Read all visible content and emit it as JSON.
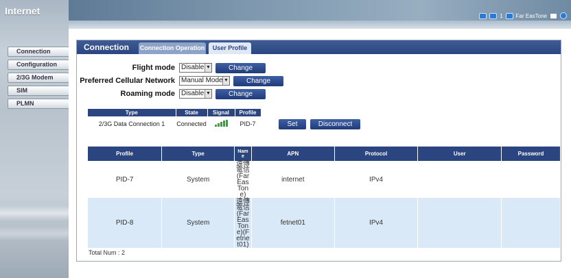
{
  "app": {
    "title": "Internet"
  },
  "sidebar": {
    "items": [
      {
        "label": "Connection"
      },
      {
        "label": "Configuration"
      },
      {
        "label": "2/3G Modem"
      },
      {
        "label": "SIM"
      },
      {
        "label": "PLMN"
      }
    ]
  },
  "status_bar": {
    "count": "1",
    "operator": "Far EasTone"
  },
  "panel": {
    "title": "Connection",
    "tabs": [
      {
        "label": "Connection Operation",
        "active": false
      },
      {
        "label": "User Profile",
        "active": true
      }
    ]
  },
  "form": {
    "flight_mode": {
      "label": "Flight mode",
      "value": "Disable",
      "button": "Change"
    },
    "preferred_network": {
      "label": "Preferred Cellular Network",
      "value": "Manual Mode",
      "button": "Change"
    },
    "roaming_mode": {
      "label": "Roaming mode",
      "value": "Disable",
      "button": "Change"
    }
  },
  "connection_status": {
    "headers": [
      "Type",
      "State",
      "Signal",
      "Profile"
    ],
    "row": {
      "type": "2/3G Data Connection 1",
      "state": "Connected",
      "signal_bars": 5,
      "profile": "PID-7"
    },
    "set_button": "Set",
    "disconnect_button": "Disconnect"
  },
  "profiles": {
    "headers": [
      "Profile",
      "Type",
      "Nam\ne",
      "APN",
      "Protocol",
      "User",
      "Password"
    ],
    "rows": [
      {
        "profile": "PID-7",
        "type": "System",
        "name": "遠傳電信(Far EasTone)",
        "apn": "internet",
        "protocol": "IPv4",
        "user": "",
        "password": ""
      },
      {
        "profile": "PID-8",
        "type": "System",
        "name": "遠傳電信(Far EasTone)(Fetnet01)",
        "apn": "fetnet01",
        "protocol": "IPv4",
        "user": "",
        "password": ""
      }
    ],
    "total": "Total Num : 2"
  },
  "colors": {
    "accent": "#2b4580",
    "row_alt": "#d9e9f7",
    "signal": "#2fa82f"
  }
}
